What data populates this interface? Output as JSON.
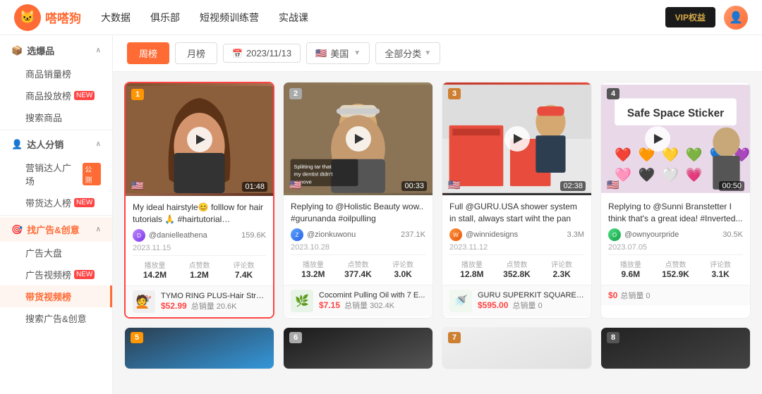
{
  "app": {
    "name": "嗒嗒狗",
    "logo_text": "嗒嗒狗"
  },
  "nav": {
    "items": [
      {
        "label": "大数据",
        "has_arrow": true
      },
      {
        "label": "俱乐部",
        "has_arrow": true
      },
      {
        "label": "短视频训练营",
        "has_arrow": false
      },
      {
        "label": "实战课",
        "has_arrow": true
      }
    ],
    "vip_label": "VIP权益",
    "avatar_text": "U"
  },
  "sidebar": {
    "sections": [
      {
        "header": "选爆品",
        "header_icon": "📦",
        "items": [
          {
            "label": "商品销量榜",
            "badge": null
          },
          {
            "label": "商品投放榜",
            "badge": "NEW",
            "badge_type": "hot"
          },
          {
            "label": "搜索商品",
            "badge": null
          }
        ]
      },
      {
        "header": "达人分销",
        "header_icon": "👤",
        "items": [
          {
            "label": "营销达人广场",
            "badge": "公测"
          },
          {
            "label": "带货达人榜",
            "badge": "NEW",
            "badge_type": "hot"
          }
        ]
      },
      {
        "header": "找广告&创意",
        "header_icon": "🎯",
        "items": [
          {
            "label": "广告大盘",
            "badge": null
          },
          {
            "label": "广告视频榜",
            "badge": "NEW",
            "badge_type": "hot"
          },
          {
            "label": "带货视频榜",
            "badge": null,
            "active": true
          },
          {
            "label": "搜索广告&创意",
            "badge": null
          }
        ]
      }
    ]
  },
  "filter": {
    "tabs": [
      {
        "label": "周榜",
        "active": true
      },
      {
        "label": "月榜",
        "active": false
      }
    ],
    "date": "2023/11/13",
    "country": "美国",
    "country_flag": "🇺🇸",
    "category": "全部分类"
  },
  "videos": [
    {
      "rank": "1",
      "rank_class": "rank1",
      "duration": "01:48",
      "flag": "🇺🇸",
      "title": "My ideal hairstyle😊 folllow for hair tutorials 🙏 #hairtutorial #hairstyle...",
      "author": "@danielleathena",
      "author_color": "purple",
      "followers": "159.6K",
      "date": "2023.11.15",
      "stats": [
        {
          "label": "播放量",
          "value": "14.2M"
        },
        {
          "label": "点赞数",
          "value": "1.2M"
        },
        {
          "label": "评论数",
          "value": "7.4K"
        }
      ],
      "product_name": "TYMO RING PLUS-Hair Straig...",
      "product_price": "$52.99",
      "product_sales": "总销量 20.6K",
      "highlighted": true
    },
    {
      "rank": "2",
      "rank_class": "rank2",
      "duration": "00:33",
      "flag": "🇺🇸",
      "title": "Replying to @Holistic Beauty wow.. #gurunanda #oilpulling",
      "author": "@zionkuwonu",
      "author_color": "blue",
      "followers": "237.1K",
      "date": "2023.10.28",
      "stats": [
        {
          "label": "播放量",
          "value": "13.2M"
        },
        {
          "label": "点赞数",
          "value": "377.4K"
        },
        {
          "label": "评论数",
          "value": "3.0K"
        }
      ],
      "product_name": "Cocomint Pulling Oil with 7 E...",
      "product_price": "$7.15",
      "product_sales": "总销量 302.4K",
      "highlighted": false
    },
    {
      "rank": "3",
      "rank_class": "rank3",
      "duration": "02:38",
      "flag": "🇺🇸",
      "title": "Full @GURU.USA shower system in stall, always start wiht the pan fir...",
      "author": "@winnidesigns",
      "author_color": "orange",
      "followers": "3.3M",
      "date": "2023.11.12",
      "stats": [
        {
          "label": "播放量",
          "value": "12.8M"
        },
        {
          "label": "点赞数",
          "value": "352.8K"
        },
        {
          "label": "评论数",
          "value": "2.3K"
        }
      ],
      "product_name": "GURU SUPERKIT SQUARE 36\"...",
      "product_price": "$595.00",
      "product_sales": "总销量 0",
      "highlighted": false
    },
    {
      "rank": "4",
      "rank_class": "rank4",
      "duration": "00:50",
      "flag": "🇺🇸",
      "title": "Replying to @Sunni Branstetter I think that's a great idea! #Inverted...",
      "author": "@ownyourpride",
      "author_color": "green",
      "followers": "30.5K",
      "date": "2023.07.05",
      "stats": [
        {
          "label": "播放量",
          "value": "9.6M"
        },
        {
          "label": "点赞数",
          "value": "152.9K"
        },
        {
          "label": "评论数",
          "value": "3.1K"
        }
      ],
      "product_name": "",
      "product_price": "$0",
      "product_sales": "总销量 0",
      "highlighted": false
    }
  ],
  "row2": [
    {
      "rank": "5",
      "thumb_class": "thumb-5"
    },
    {
      "rank": "6",
      "thumb_class": "thumb-6"
    },
    {
      "rank": "7",
      "thumb_class": "thumb-7"
    },
    {
      "rank": "8",
      "thumb_class": "thumb-8"
    }
  ]
}
